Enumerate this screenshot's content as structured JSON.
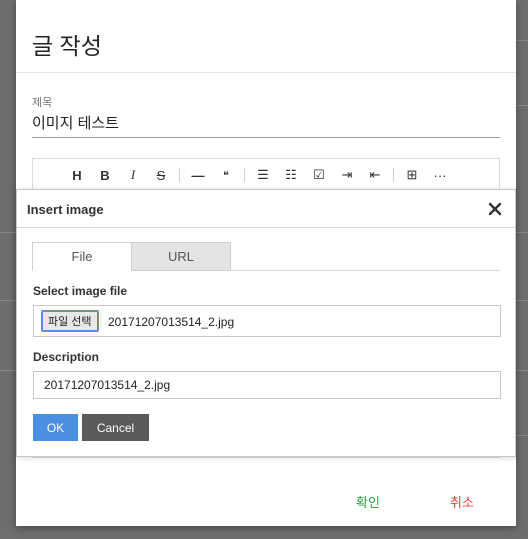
{
  "post_dialog": {
    "title": "글 작성",
    "subject_label": "제목",
    "subject_value": "이미지 테스트",
    "toolbar": [
      {
        "icon": "heading-icon",
        "glyph": "H"
      },
      {
        "icon": "bold-icon",
        "glyph": "B"
      },
      {
        "icon": "italic-icon",
        "glyph": "I"
      },
      {
        "icon": "strikethrough-icon",
        "glyph": "S"
      },
      {
        "icon": "horizontal-rule-icon",
        "glyph": "—"
      },
      {
        "icon": "quote-icon",
        "glyph": "❝"
      },
      {
        "icon": "bullet-list-icon",
        "glyph": "☰"
      },
      {
        "icon": "numbered-list-icon",
        "glyph": "☷"
      },
      {
        "icon": "task-list-icon",
        "glyph": "☑"
      },
      {
        "icon": "indent-icon",
        "glyph": "⇥"
      },
      {
        "icon": "outdent-icon",
        "glyph": "⇤"
      },
      {
        "icon": "table-icon",
        "glyph": "⊞"
      },
      {
        "icon": "more-icon",
        "glyph": "···"
      }
    ],
    "confirm_label": "확인",
    "cancel_label": "취소",
    "colors": {
      "confirm": "#2e9e3e",
      "cancel": "#e0433b"
    }
  },
  "insert_image": {
    "title": "Insert image",
    "tabs": {
      "file": "File",
      "url": "URL"
    },
    "select_file_label": "Select image file",
    "choose_file_button": "파일 선택",
    "file_name": "20171207013514_2.jpg",
    "description_label": "Description",
    "description_value": "20171207013514_2.jpg",
    "ok_label": "OK",
    "cancel_label": "Cancel",
    "colors": {
      "ok": "#4b8fe0",
      "cancel": "#5a5a5a"
    }
  }
}
